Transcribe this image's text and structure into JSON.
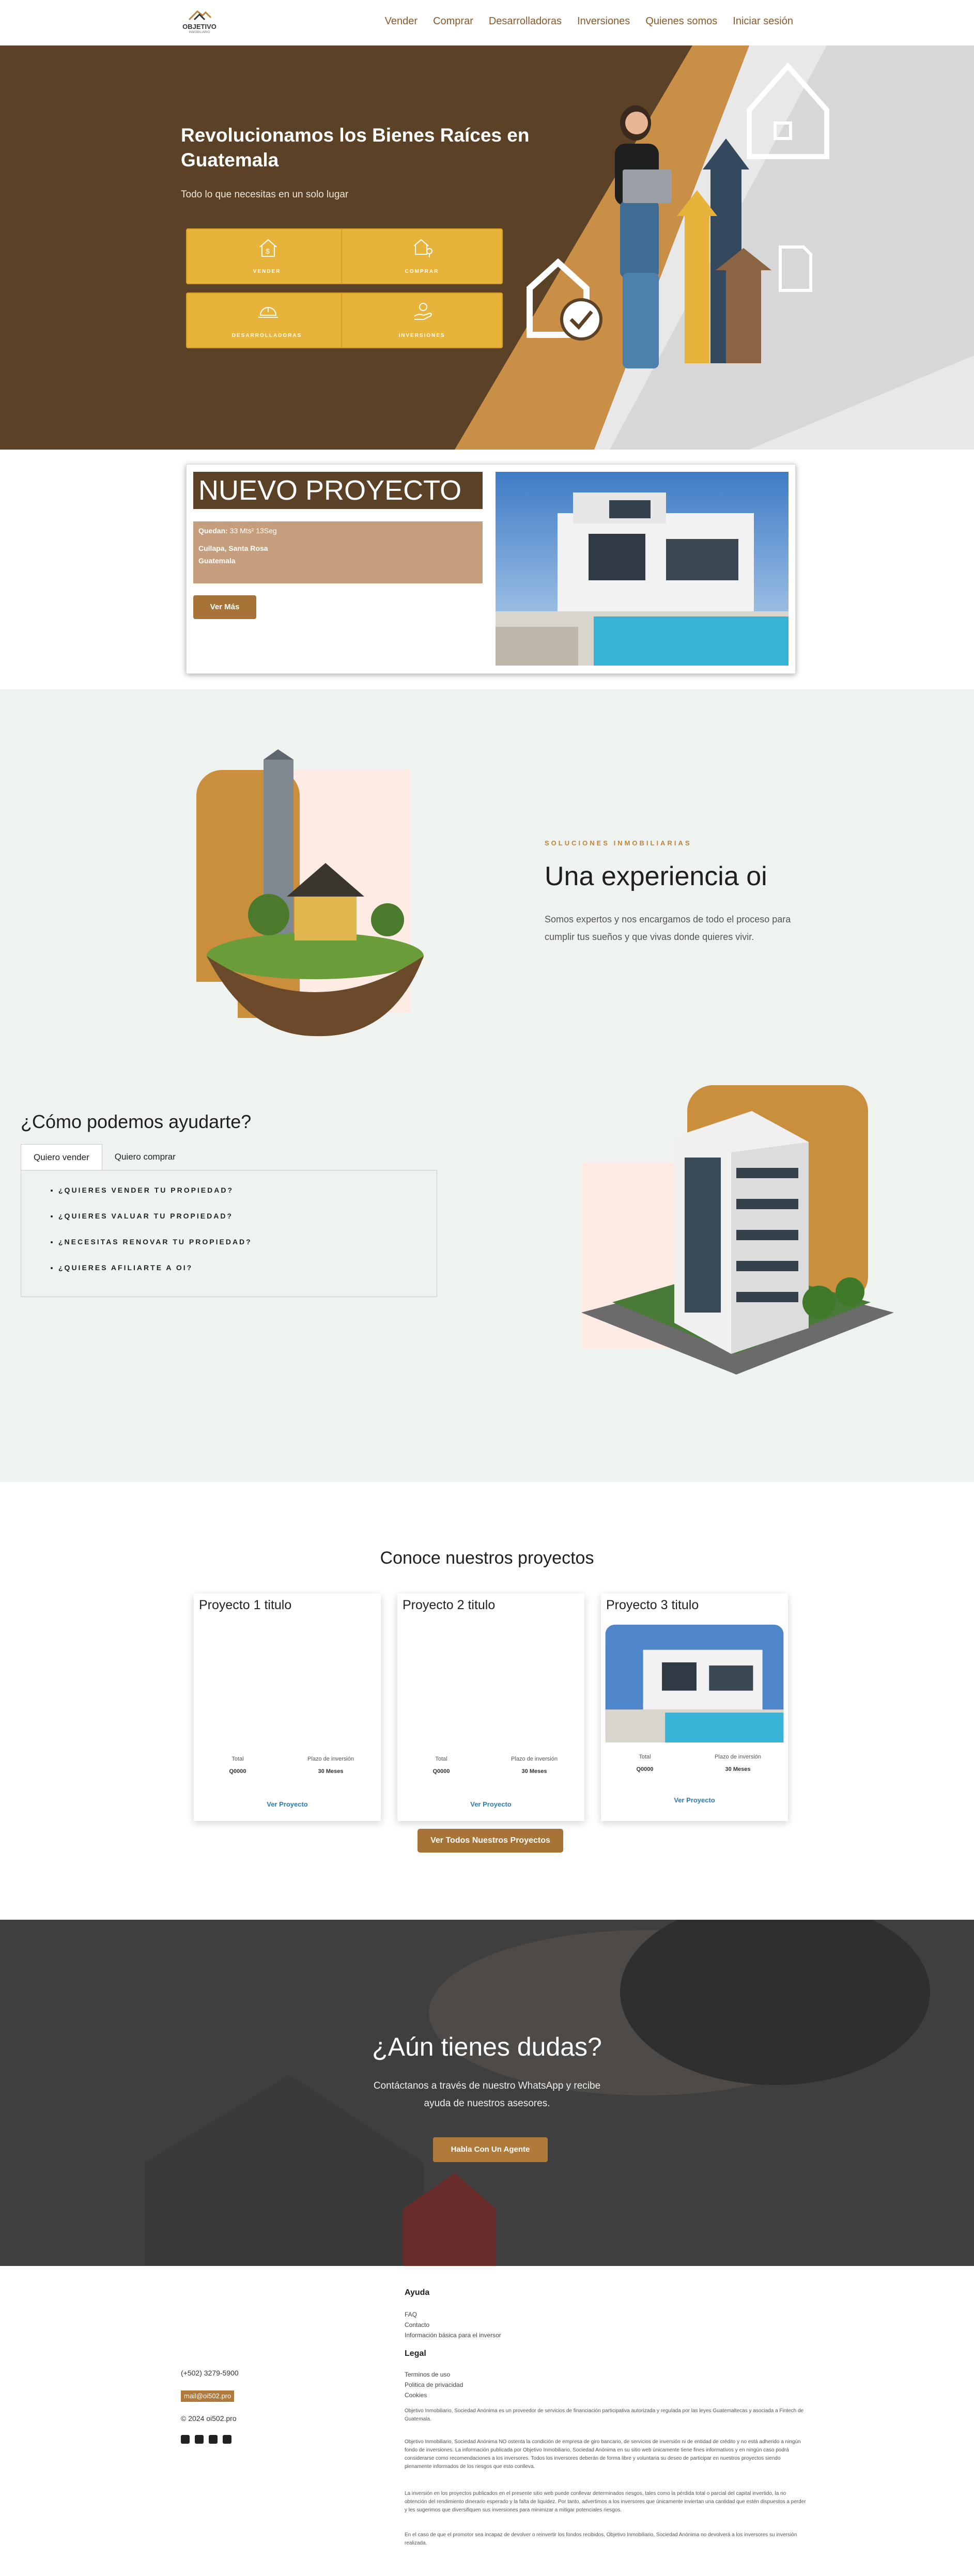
{
  "header": {
    "logo_name": "OBJETIVO",
    "logo_sub": "INMOBILIARIO",
    "nav": [
      "Vender",
      "Comprar",
      "Desarrolladoras",
      "Inversiones",
      "Quienes somos",
      "Iniciar sesión"
    ]
  },
  "hero": {
    "title": "Revolucionamos los Bienes Raíces en Guatemala",
    "subtitle": "Todo lo que necesitas en un solo lugar",
    "cards": [
      "VENDER",
      "COMPRAR",
      "DESARROLLADORAS",
      "INVERSIONES"
    ]
  },
  "project": {
    "title": "NUEVO PROYECTO",
    "quedan_label": "Quedan:",
    "quedan_value": "33 Mts² 13Seg",
    "location": "Cuilapa, Santa Rosa",
    "country": "Guatemala",
    "button": "Ver Más"
  },
  "soluciones": {
    "eyebrow": "SOLUCIONES INMOBILIARIAS",
    "title": "Una experiencia oi",
    "text": "Somos expertos y nos encargamos de todo el proceso para cumplir tus sueños y que vivas donde quieres vivir."
  },
  "help": {
    "title": "¿Cómo podemos ayudarte?",
    "tabs": [
      "Quiero vender",
      "Quiero comprar"
    ],
    "items": [
      "¿QUIERES VENDER TU PROPIEDAD?",
      "¿QUIERES VALUAR TU PROPIEDAD?",
      "¿NECESITAS RENOVAR TU PROPIEDAD?",
      "¿QUIERES AFILIARTE A OI?"
    ]
  },
  "proyectos": {
    "title": "Conoce nuestros proyectos",
    "cards": [
      {
        "title": "Proyecto 1 titulo",
        "total_label": "Total",
        "total": "Q0000",
        "plazo_label": "Plazo de inversión",
        "plazo": "30 Meses",
        "link": "Ver Proyecto"
      },
      {
        "title": "Proyecto 2 titulo",
        "total_label": "Total",
        "total": "Q0000",
        "plazo_label": "Plazo de inversión",
        "plazo": "30 Meses",
        "link": "Ver Proyecto"
      },
      {
        "title": "Proyecto 3 titulo",
        "total_label": "Total",
        "total": "Q0000",
        "plazo_label": "Plazo de inversión",
        "plazo": "30 Meses",
        "link": "Ver Proyecto"
      }
    ],
    "all_button": "Ver Todos Nuestros Proyectos"
  },
  "cta": {
    "title": "¿Aún tienes dudas?",
    "text": "Contáctanos a través de nuestro WhatsApp y recibe ayuda de nuestros asesores.",
    "button": "Habla Con Un Agente"
  },
  "footer": {
    "phone": "(+502) 3279-5900",
    "email": "mail@oi502.pro",
    "copyright": "© 2024 oi502.pro",
    "ayuda_title": "Ayuda",
    "ayuda_links": [
      "FAQ",
      "Contacto",
      "Información básica para el inversor"
    ],
    "legal_title": "Legal",
    "legal_links": [
      "Terminos de uso",
      "Politica de privacidad",
      "Cookies"
    ],
    "p1": "Objetivo Inmobiliario, Sociedad Anónima es un proveedor de servicios de financiación participativa autorizada y regulada por las leyes Guatemaltecas y asociada a Fintech de Guatemala.",
    "p2": "Objetivo Inmobiliario, Sociedad Anónima NO ostenta la condición de empresa de giro bancario, de servicios de inversión ni de entidad de crédito y no está adherido a ningún fondo de inversiones. La información publicada por Objetivo Inmobiliario, Sociedad Anónima en su sitio web únicamente tiene fines informativos y en ningún caso podrá considerarse como recomendaciones a los inversores. Todos los inversores deberán de forma libre y voluntaria su deseo de participar en nuestros proyectos siendo plenamente informados de los riesgos que esto conlleva.",
    "p3": "La inversión en los proyectos publicados en el presente sitio web puede conllevar determinados riesgos, tales como la pérdida total o parcial del capital invertido, la no obtención del rendimiento dinerario esperado y la falta de liquidez. Por tanto, advertimos a los inversores que únicamente inviertan una cantidad que estén dispuestos a perder y les sugerimos que diversifiquen sus inversiones para minimizar a mitigar potenciales riesgos.",
    "p4": "En el caso de que el promotor sea incapaz de devolver o reinvertir los fondos recibidos, Objetivo Inmobiliario, Sociedad Anónima no devolverá a los inversores su inversión realizada."
  },
  "colors": {
    "brown": "#5b4125",
    "gold": "#e8b33a",
    "orange": "#d49b4a",
    "button": "#a87337",
    "mint": "#eef3ef"
  }
}
